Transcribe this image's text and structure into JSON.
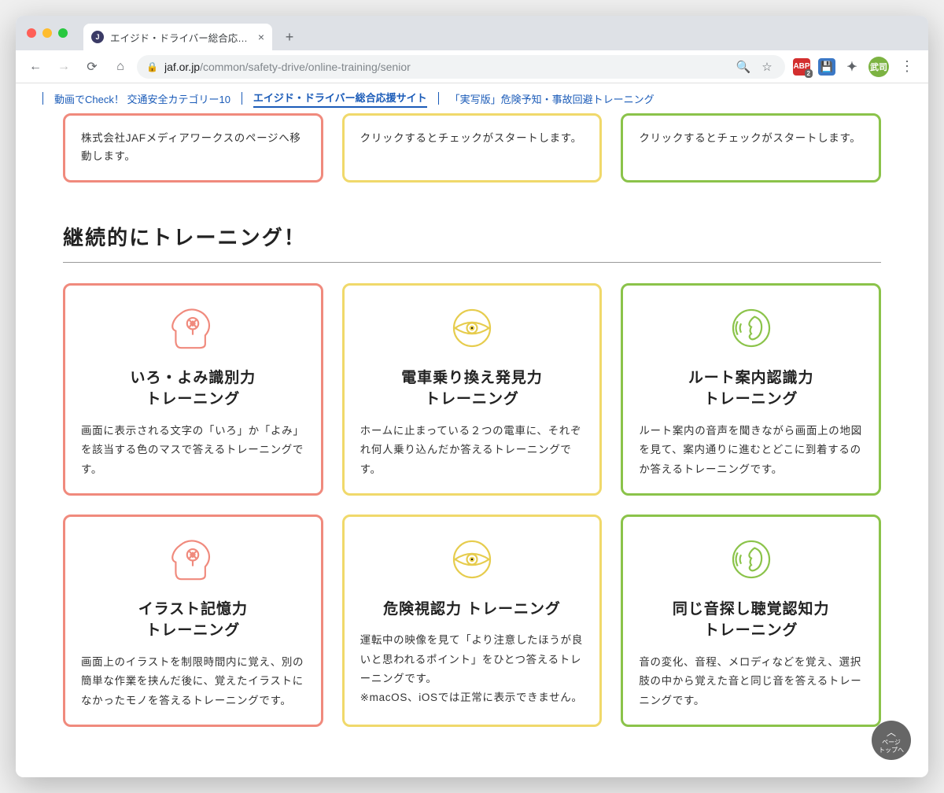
{
  "browser": {
    "tab_title": "エイジド・ドライバー総合応援サ",
    "url_domain": "jaf.or.jp",
    "url_path": "/common/safety-drive/online-training/senior",
    "avatar_initials": "武司",
    "abp_badge": "2"
  },
  "subnav": {
    "item1": "動画でCheck！ 交通安全カテゴリー10",
    "item2": "エイジド・ドライバー総合応援サイト",
    "item3": "「実写版」危険予知・事故回避トレーニング"
  },
  "top_row": {
    "c1": "株式会社JAFメディアワークスのページへ移動します。",
    "c2": "クリックするとチェックがスタートします。",
    "c3": "クリックするとチェックがスタートします。"
  },
  "heading": "継続的にトレーニング！",
  "cards": {
    "r1c1_title": "いろ・よみ識別力\nトレーニング",
    "r1c1_desc": "画面に表示される文字の「いろ」か「よみ」を該当する色のマスで答えるトレーニングです。",
    "r1c2_title": "電車乗り換え発見力\nトレーニング",
    "r1c2_desc": "ホームに止まっている２つの電車に、それぞれ何人乗り込んだか答えるトレーニングです。",
    "r1c3_title": "ルート案内認識力\nトレーニング",
    "r1c3_desc": "ルート案内の音声を聞きながら画面上の地図を見て、案内通りに進むとどこに到着するのか答えるトレーニングです。",
    "r2c1_title": "イラスト記憶力\nトレーニング",
    "r2c1_desc": "画面上のイラストを制限時間内に覚え、別の簡単な作業を挟んだ後に、覚えたイラストになかったモノを答えるトレーニングです。",
    "r2c2_title": "危険視認力 トレーニング",
    "r2c2_desc": "運転中の映像を見て「より注意したほうが良いと思われるポイント」をひとつ答えるトレーニングです。\n※macOS、iOSでは正常に表示できません。",
    "r2c3_title": "同じ音探し聴覚認知力\nトレーニング",
    "r2c3_desc": "音の変化、音程、メロディなどを覚え、選択肢の中から覚えた音と同じ音を答えるトレーニングです。"
  },
  "back_to_top": {
    "l1": "ページ",
    "l2": "トップへ"
  }
}
